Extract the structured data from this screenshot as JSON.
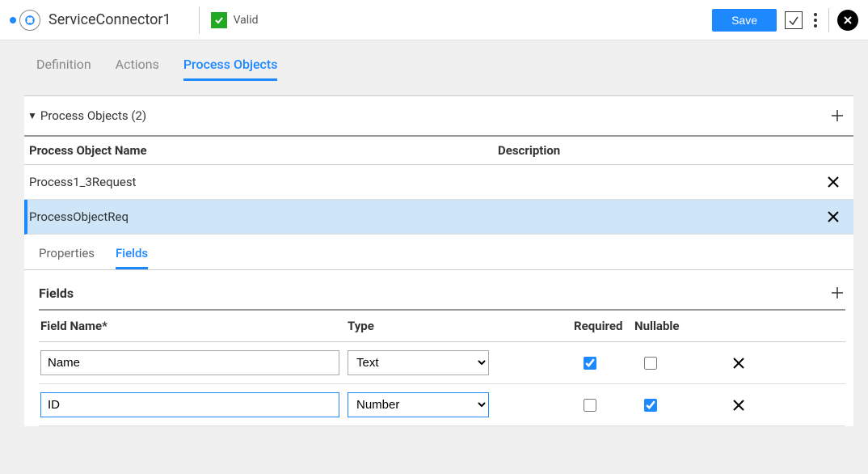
{
  "header": {
    "title": "ServiceConnector1",
    "valid_label": "Valid",
    "save_label": "Save"
  },
  "top_tabs": [
    {
      "label": "Definition"
    },
    {
      "label": "Actions"
    },
    {
      "label": "Process Objects"
    }
  ],
  "po_panel": {
    "title": "Process Objects (2)",
    "columns": {
      "name": "Process Object Name",
      "desc": "Description"
    },
    "rows": [
      {
        "name": "Process1_3Request",
        "desc": ""
      },
      {
        "name": "ProcessObjectReq",
        "desc": ""
      }
    ]
  },
  "sub_tabs": [
    {
      "label": "Properties"
    },
    {
      "label": "Fields"
    }
  ],
  "fields_section": {
    "title": "Fields",
    "columns": {
      "name": "Field Name*",
      "type": "Type",
      "req": "Required",
      "null": "Nullable"
    },
    "rows": [
      {
        "name": "Name",
        "type": "Text",
        "required": true,
        "nullable": false
      },
      {
        "name": "ID",
        "type": "Number",
        "required": false,
        "nullable": true
      }
    ]
  }
}
